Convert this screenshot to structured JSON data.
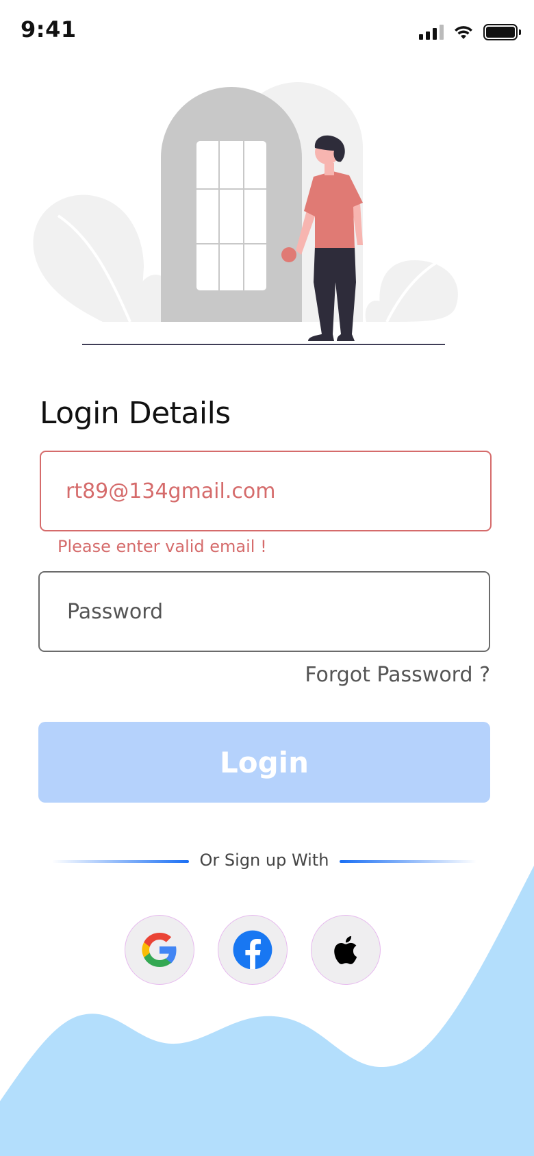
{
  "status_bar": {
    "time": "9:41",
    "icons": [
      "cellular-signal-icon",
      "wifi-icon",
      "battery-icon"
    ]
  },
  "illustration": {
    "name": "person-at-door-illustration"
  },
  "login": {
    "title": "Login Details",
    "email": {
      "value": "rt89@134gmail.com",
      "error": "Please enter valid email !",
      "state": "error"
    },
    "password": {
      "placeholder": "Password",
      "value": ""
    },
    "forgot_label": "Forgot Password ?",
    "button_label": "Login",
    "button_state": "disabled"
  },
  "social": {
    "divider_label": "Or Sign up With",
    "providers": [
      {
        "name": "Google",
        "icon": "google-icon"
      },
      {
        "name": "Facebook",
        "icon": "facebook-icon"
      },
      {
        "name": "Apple",
        "icon": "apple-icon"
      }
    ]
  },
  "colors": {
    "error": "#d56b6b",
    "button_disabled": "#b5d2fc",
    "accent": "#1a6ff4",
    "wave": "#b3defc",
    "figure_shirt": "#e07a74",
    "figure_pants": "#2e2c3a"
  }
}
